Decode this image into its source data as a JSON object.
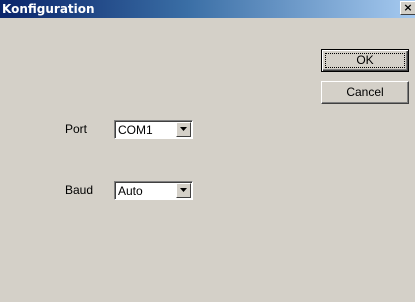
{
  "window": {
    "title": "Konfiguration",
    "close_glyph": "×"
  },
  "buttons": {
    "ok_label": "OK",
    "cancel_label": "Cancel"
  },
  "fields": {
    "port": {
      "label": "Port",
      "value": "COM1"
    },
    "baud": {
      "label": "Baud",
      "value": "Auto"
    }
  },
  "icons": {
    "close": "close-icon",
    "dropdown": "chevron-down-icon"
  },
  "colors": {
    "title_bar_start": "#0a246a",
    "title_bar_end": "#a6caf0",
    "dialog_face": "#d4d0c8"
  }
}
